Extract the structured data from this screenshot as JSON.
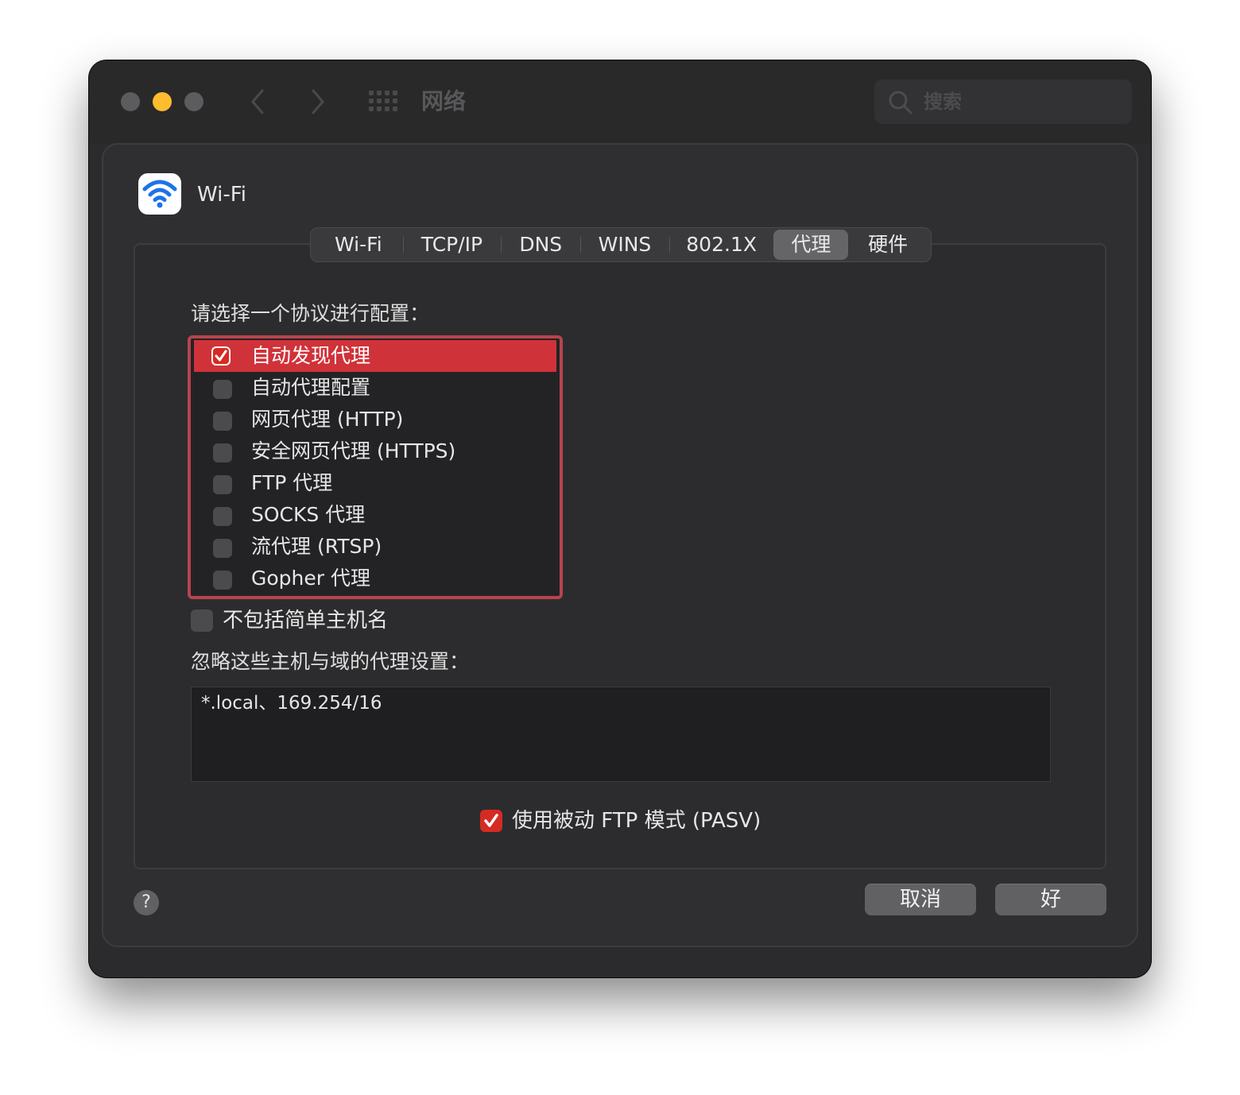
{
  "window": {
    "title": "网络",
    "search_placeholder": "搜索"
  },
  "interface": {
    "name": "Wi-Fi"
  },
  "tabs": [
    {
      "label": "Wi-Fi"
    },
    {
      "label": "TCP/IP"
    },
    {
      "label": "DNS"
    },
    {
      "label": "WINS"
    },
    {
      "label": "802.1X"
    },
    {
      "label": "代理",
      "active": true
    },
    {
      "label": "硬件"
    }
  ],
  "proxy": {
    "select_protocol_label": "请选择一个协议进行配置：",
    "protocols": [
      {
        "label": "自动发现代理",
        "checked": true,
        "selected": true
      },
      {
        "label": "自动代理配置",
        "checked": false
      },
      {
        "label": "网页代理 (HTTP)",
        "checked": false
      },
      {
        "label": "安全网页代理 (HTTPS)",
        "checked": false
      },
      {
        "label": "FTP 代理",
        "checked": false
      },
      {
        "label": "SOCKS 代理",
        "checked": false
      },
      {
        "label": "流代理 (RTSP)",
        "checked": false
      },
      {
        "label": "Gopher 代理",
        "checked": false
      }
    ],
    "exclude_simple_hostnames": {
      "label": "不包括简单主机名",
      "checked": false
    },
    "bypass_label": "忽略这些主机与域的代理设置：",
    "bypass_value": "*.local、169.254/16",
    "passive_ftp": {
      "label": "使用被动 FTP 模式 (PASV)",
      "checked": true
    }
  },
  "footer": {
    "help_label": "?",
    "cancel_label": "取消",
    "ok_label": "好"
  },
  "colors": {
    "accent": "#d52b23",
    "selection": "#d03239",
    "focus_ring": "#b8434e"
  }
}
